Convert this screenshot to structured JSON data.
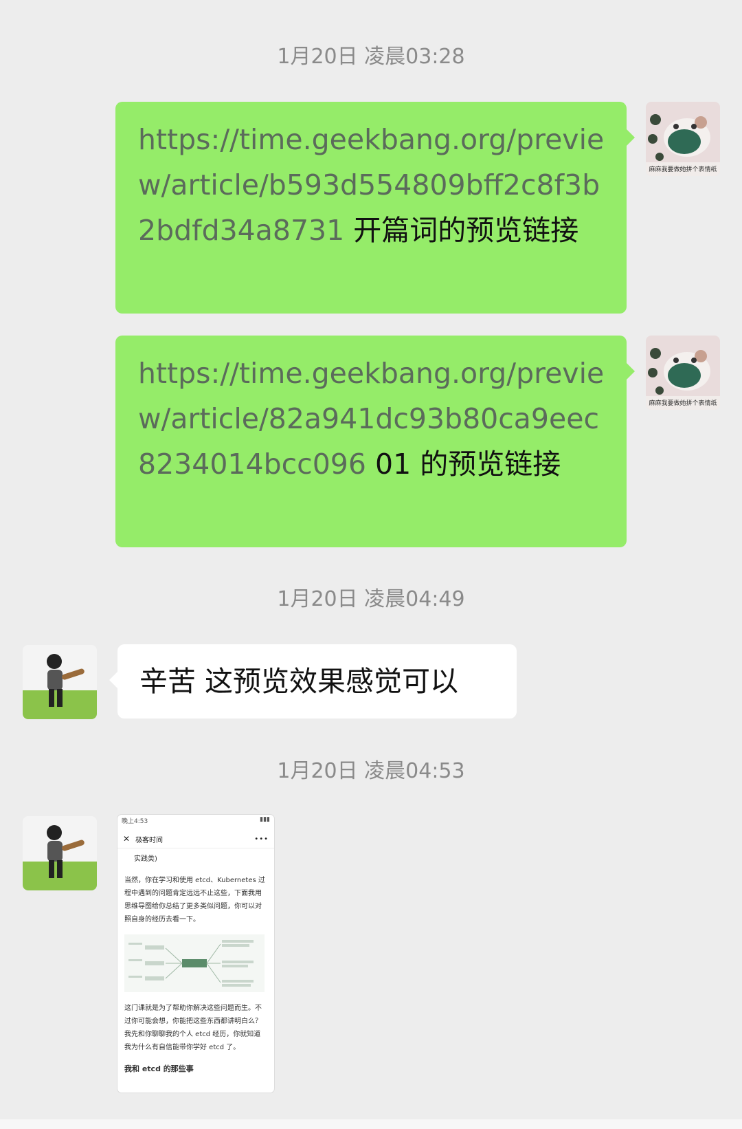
{
  "timestamps": [
    "1月20日 凌晨03:28",
    "1月20日 凌晨04:49",
    "1月20日 凌晨04:53"
  ],
  "messages": [
    {
      "link": "https://time.geekbang.org/preview/article/b593d554809bff2c8f3b2bdfd34a8731",
      "text": " 开篇词的预览链接"
    },
    {
      "link": "https://time.geekbang.org/preview/article/82a941dc93b80ca9eec8234014bcc096",
      "text": " 01 的预览链接"
    },
    {
      "text": "辛苦 这预览效果感觉可以"
    }
  ],
  "avatar_self_caption": "麻麻我要做她拼个表情纸",
  "screenshot": {
    "status_time": "晚上4:53",
    "title": "极客时间",
    "line0": "实践类)",
    "para1": "当然，你在学习和使用 etcd、Kubernetes 过程中遇到的问题肯定远远不止这些，下面我用思维导图给你总结了更多类似问题，你可以对照自身的经历去看一下。",
    "para2": "这门课就是为了帮助你解决这些问题而生。不过你可能会想，你能把这些东西都讲明白么？我先和你聊聊我的个人 etcd 经历，你就知道我为什么有自信能带你学好 etcd 了。",
    "heading": "我和 etcd 的那些事"
  },
  "colors": {
    "green_bubble": "#95ec69",
    "background": "#ededed"
  }
}
